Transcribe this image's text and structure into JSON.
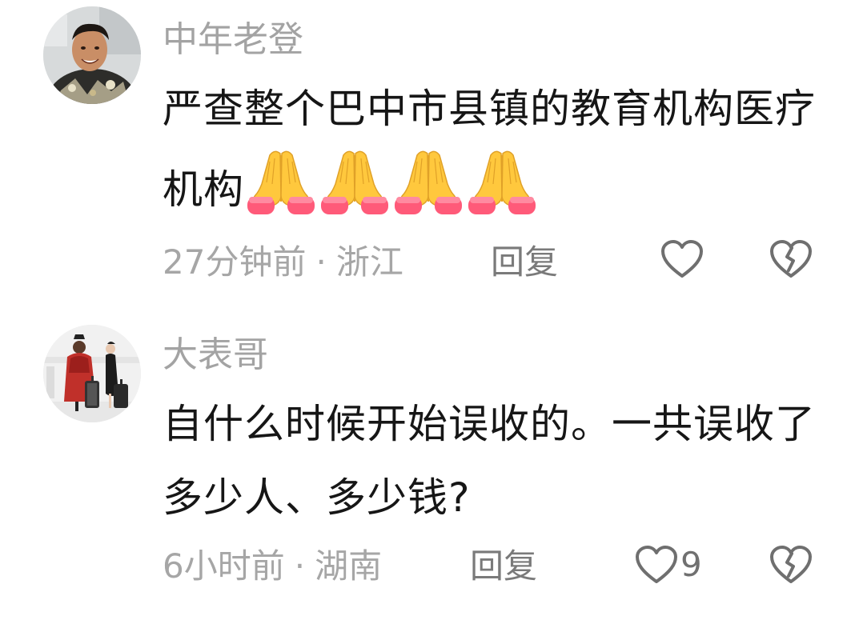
{
  "comments": [
    {
      "username": "中年老登",
      "text": "严查整个巴中市县镇的教育机构医疗机构",
      "emoji": "folded-hands",
      "emoji_count": 4,
      "time": "27分钟前",
      "location": "浙江",
      "reply_label": "回复",
      "like_count": ""
    },
    {
      "username": "大表哥",
      "text": "自什么时候开始误收的。一共误收了多少人、多少钱?",
      "time": "6小时前",
      "location": "湖南",
      "reply_label": "回复",
      "like_count": "9"
    }
  ],
  "separator": "·",
  "icons": {
    "like": "heart-outline-icon",
    "dislike": "broken-heart-icon",
    "emoji": "folded-hands-icon"
  },
  "colors": {
    "text": "#161616",
    "username": "#a3a3a3",
    "meta": "#a6a6a6",
    "icon": "#6f6f6f",
    "emoji": "#ffc83d"
  }
}
